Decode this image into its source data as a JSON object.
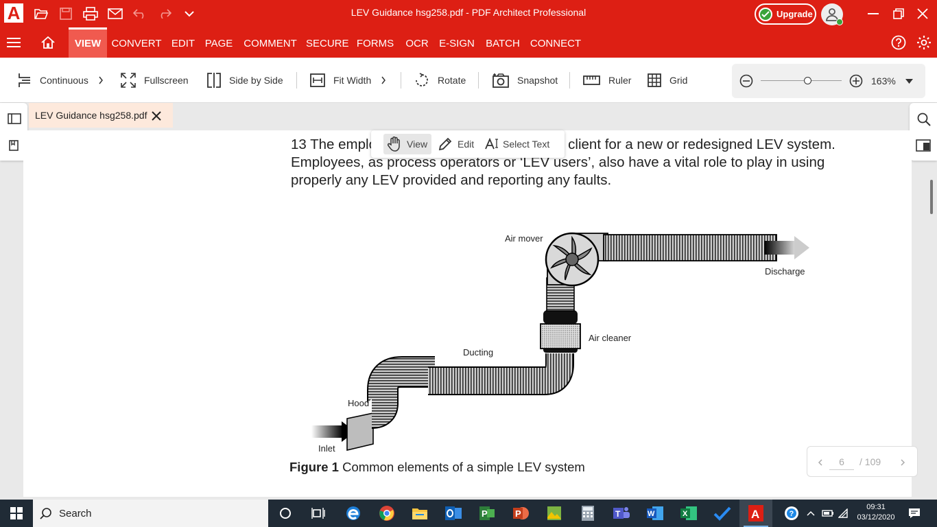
{
  "window": {
    "title": "LEV Guidance hsg258.pdf   -   PDF Architect Professional",
    "app_icon": "A",
    "upgrade_label": "Upgrade"
  },
  "menu": {
    "items": [
      "VIEW",
      "CONVERT",
      "EDIT",
      "PAGE",
      "COMMENT",
      "SECURE",
      "FORMS",
      "OCR",
      "E-SIGN",
      "BATCH",
      "CONNECT"
    ],
    "active": "VIEW",
    "search_placeholder": ""
  },
  "toolbar": {
    "continuous": "Continuous",
    "fullscreen": "Fullscreen",
    "side_by_side": "Side by Side",
    "fit_width": "Fit Width",
    "rotate": "Rotate",
    "snapshot": "Snapshot",
    "ruler": "Ruler",
    "grid": "Grid",
    "zoom": "163%",
    "zoom_level": 0.58
  },
  "tab": {
    "label": "LEV Guidance hsg258.pdf"
  },
  "modes": {
    "view": "View",
    "edit": "Edit",
    "select_text": "Select Text",
    "active": "View"
  },
  "document": {
    "paragraph": "13  The employer has the key role and is the client for a new or redesigned LEV system. Employees, as process operators or ‘LEV users’, also have a vital role to play in using properly any LEV provided and reporting any faults.",
    "labels": {
      "air_mover": "Air mover",
      "discharge": "Discharge",
      "air_cleaner": "Air cleaner",
      "ducting": "Ducting",
      "hood": "Hood",
      "inlet": "Inlet"
    },
    "caption_bold": "Figure 1",
    "caption_rest": " Common elements of a simple LEV system"
  },
  "pager": {
    "current": "6",
    "total": "/ 109"
  },
  "taskbar": {
    "search": "Search",
    "time": "09:31",
    "date": "03/12/2020"
  },
  "colors": {
    "brand": "#dd1f14",
    "brand_light": "#f05a4f",
    "tab_bg": "#fde9dc",
    "taskbar": "#202b36"
  }
}
